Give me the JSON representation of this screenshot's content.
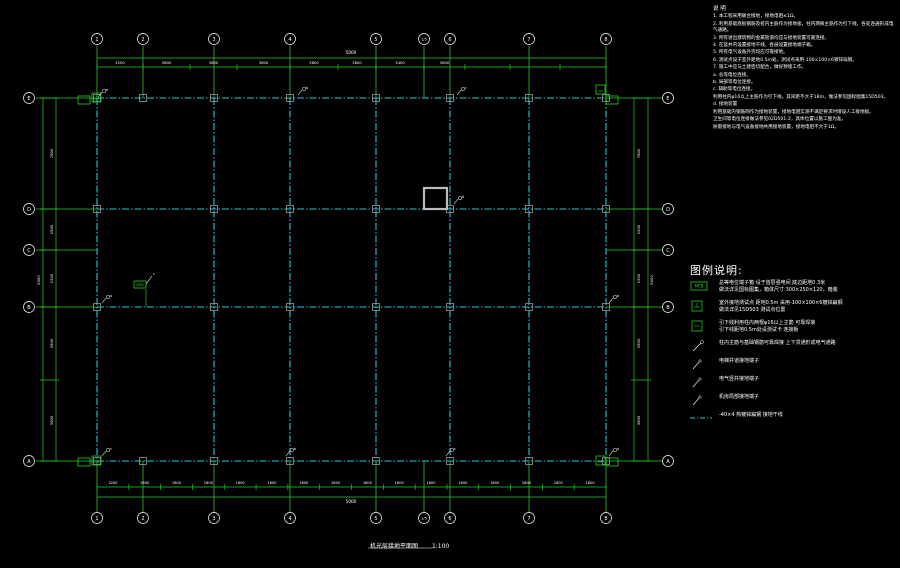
{
  "drawing": {
    "caption_title": "机光层接地平面图",
    "caption_scale": "1:100",
    "axes_vertical": [
      "1",
      "2",
      "3",
      "4",
      "5",
      "1/5",
      "6",
      "7",
      "8"
    ],
    "axes_horizontal": [
      "E",
      "D",
      "C",
      "B",
      "A"
    ],
    "overall_dim_top": "5000",
    "overall_dim_bottom": "5000",
    "overall_dim_side": "5000",
    "top_segment_dims": [
      "3200",
      "3600",
      "3600",
      "3600",
      "3800",
      "3800",
      "3400",
      "3600"
    ],
    "bottom_segment_dims": [
      "3200",
      "1800",
      "1800",
      "1800",
      "1800",
      "1800",
      "1800",
      "1800",
      "1800",
      "1800",
      "1800",
      "1800",
      "1800",
      "1800",
      "1800",
      "1800"
    ],
    "side_dims": [
      "7800",
      "1500",
      "1500",
      "3900",
      "3900"
    ],
    "marker_letters": [
      "a",
      "b",
      "c",
      "d"
    ],
    "ground_box_label": "MEB"
  },
  "notes": {
    "heading": "说 明",
    "lines": [
      "1. 本工程采用联合接地，接地电阻≤1Ω。",
      "2. 利用基础底板钢筋及桩内主筋作为接地极，柱内两根主筋作为引下线，各处连通形成电气通路。",
      "3. 所有进出建筑物的金属管道均应与接地装置可靠连接。",
      "4. 在竖井内设置接地干线，各层设置接地端子箱。",
      "5. 所有电气设备外壳均应可靠接地。",
      "6. 测试点设于室外距地0.5m处，测试点采用-100×100×6镀锌扁钢。",
      "7. 施工中应与土建密切配合，做好预埋工作。",
      "a. 总等电位连接。",
      "b. 局部等电位连接。",
      "c. 辅助等电位连接。",
      "利用柱内φ16以上主筋作为引下线，其间距不大于18m，做法参见国标图集15D503。",
      "d. 接地装置",
      "利用基础内钢筋网作为接地装置，接地电阻实测不满足要求时增设人工接地极。",
      "卫生间等电位连接做法参见02D501-2，具体位置以施工图为准。",
      "防雷接地与电气设备接地共用接地装置，接地电阻不大于1Ω。"
    ]
  },
  "legend": {
    "title": "图例说明:",
    "items": [
      {
        "lines": [
          "总等电位端子箱 设于首层强电间 底边距地0.3米",
          "做法详见国标图集，箱体尺寸 300×250×120，暗装"
        ]
      },
      {
        "lines": [
          "室外接地测试点 距地0.5m 采用-100×100×6镀锌扁钢",
          "做法详见15D503 测试点位置"
        ]
      },
      {
        "lines": [
          "引下线利用柱内两根φ16以上主筋 可靠焊接",
          "引下线距地0.5m处设测试卡 连接板"
        ]
      },
      {
        "lines": [
          "柱内主筋与基础钢筋可靠焊接 上下贯通形成电气通路"
        ]
      },
      {
        "lines": [
          "电梯井道接地端子"
        ]
      },
      {
        "lines": [
          "电气竖井接地端子"
        ]
      },
      {
        "lines": [
          "机房局部接地端子"
        ]
      },
      {
        "lines": [
          "-40×4 热镀锌扁钢 接地干线"
        ]
      }
    ]
  },
  "colors": {
    "background": "#000000",
    "frame": "#22cc22",
    "grid_dash": "#22c8d8",
    "column": "#9a9a9a",
    "label": "#ffffff",
    "highlight": "#bbbbbb"
  }
}
